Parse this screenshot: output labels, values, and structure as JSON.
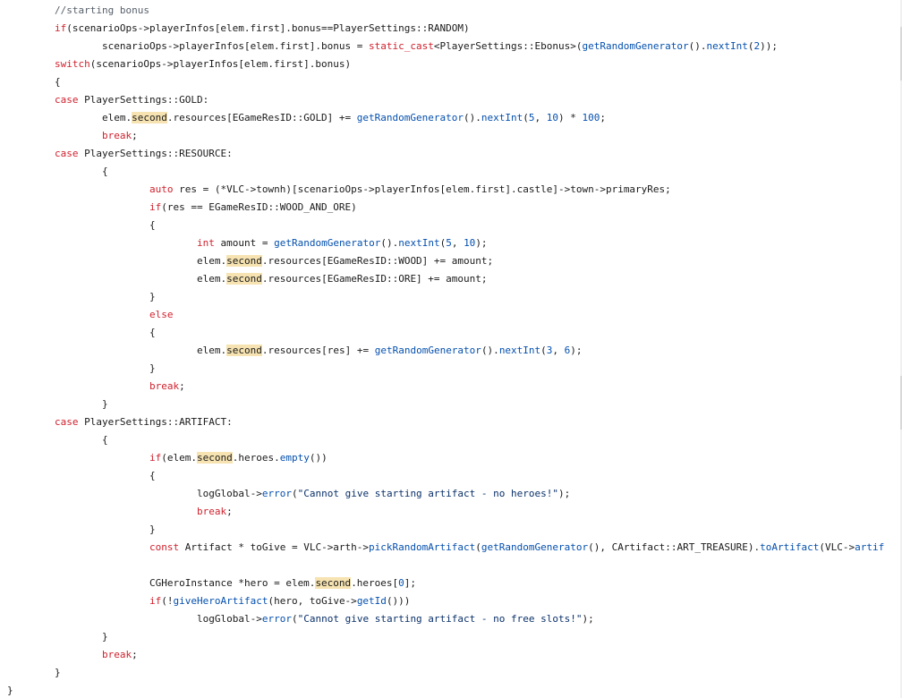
{
  "colors": {
    "keyword": "#cf222e",
    "function": "#0550ae",
    "number": "#0550ae",
    "string": "#0a3069",
    "comment": "#57606a",
    "highlight": "#f6e3b1"
  },
  "code_lines": [
    [
      [
        "\t//starting bonus",
        "cm"
      ]
    ],
    [
      [
        "\t",
        ""
      ],
      [
        "if",
        "kw"
      ],
      [
        "(scenarioOps->playerInfos[elem.first].bonus==PlayerSettings::RANDOM)",
        ""
      ]
    ],
    [
      [
        "\t\tscenarioOps->playerInfos[elem.first].bonus = ",
        ""
      ],
      [
        "static_cast",
        "kw"
      ],
      [
        "<PlayerSettings::Ebonus>(",
        ""
      ],
      [
        "getRandomGenerator",
        "fn"
      ],
      [
        "().",
        ""
      ],
      [
        "nextInt",
        "fn"
      ],
      [
        "(",
        ""
      ],
      [
        "2",
        "num"
      ],
      [
        "));",
        ""
      ]
    ],
    [
      [
        "\t",
        ""
      ],
      [
        "switch",
        "kw"
      ],
      [
        "(scenarioOps->playerInfos[elem.first].bonus)",
        ""
      ]
    ],
    [
      [
        "\t{",
        ""
      ]
    ],
    [
      [
        "\t",
        ""
      ],
      [
        "case",
        "kw"
      ],
      [
        " PlayerSettings::GOLD:",
        ""
      ]
    ],
    [
      [
        "\t\telem.",
        ""
      ],
      [
        "second",
        "hl"
      ],
      [
        ".resources[EGameResID::GOLD] += ",
        ""
      ],
      [
        "getRandomGenerator",
        "fn"
      ],
      [
        "().",
        ""
      ],
      [
        "nextInt",
        "fn"
      ],
      [
        "(",
        ""
      ],
      [
        "5",
        "num"
      ],
      [
        ", ",
        ""
      ],
      [
        "10",
        "num"
      ],
      [
        ") * ",
        ""
      ],
      [
        "100",
        "num"
      ],
      [
        ";",
        ""
      ]
    ],
    [
      [
        "\t\t",
        ""
      ],
      [
        "break",
        "kw"
      ],
      [
        ";",
        ""
      ]
    ],
    [
      [
        "\t",
        ""
      ],
      [
        "case",
        "kw"
      ],
      [
        " PlayerSettings::RESOURCE:",
        ""
      ]
    ],
    [
      [
        "\t\t{",
        ""
      ]
    ],
    [
      [
        "\t\t\t",
        ""
      ],
      [
        "auto",
        "kw"
      ],
      [
        " res = (*VLC->townh)[scenarioOps->playerInfos[elem.first].castle]->town->primaryRes;",
        ""
      ]
    ],
    [
      [
        "\t\t\t",
        ""
      ],
      [
        "if",
        "kw"
      ],
      [
        "(res == EGameResID::WOOD_AND_ORE)",
        ""
      ]
    ],
    [
      [
        "\t\t\t{",
        ""
      ]
    ],
    [
      [
        "\t\t\t\t",
        ""
      ],
      [
        "int",
        "kw"
      ],
      [
        " amount = ",
        ""
      ],
      [
        "getRandomGenerator",
        "fn"
      ],
      [
        "().",
        ""
      ],
      [
        "nextInt",
        "fn"
      ],
      [
        "(",
        ""
      ],
      [
        "5",
        "num"
      ],
      [
        ", ",
        ""
      ],
      [
        "10",
        "num"
      ],
      [
        ");",
        ""
      ]
    ],
    [
      [
        "\t\t\t\telem.",
        ""
      ],
      [
        "second",
        "hl"
      ],
      [
        ".resources[EGameResID::WOOD] += amount;",
        ""
      ]
    ],
    [
      [
        "\t\t\t\telem.",
        ""
      ],
      [
        "second",
        "hl"
      ],
      [
        ".resources[EGameResID::ORE] += amount;",
        ""
      ]
    ],
    [
      [
        "\t\t\t}",
        ""
      ]
    ],
    [
      [
        "\t\t\t",
        ""
      ],
      [
        "else",
        "kw"
      ]
    ],
    [
      [
        "\t\t\t{",
        ""
      ]
    ],
    [
      [
        "\t\t\t\telem.",
        ""
      ],
      [
        "second",
        "hl"
      ],
      [
        ".resources[res] += ",
        ""
      ],
      [
        "getRandomGenerator",
        "fn"
      ],
      [
        "().",
        ""
      ],
      [
        "nextInt",
        "fn"
      ],
      [
        "(",
        ""
      ],
      [
        "3",
        "num"
      ],
      [
        ", ",
        ""
      ],
      [
        "6",
        "num"
      ],
      [
        ");",
        ""
      ]
    ],
    [
      [
        "\t\t\t}",
        ""
      ]
    ],
    [
      [
        "\t\t\t",
        ""
      ],
      [
        "break",
        "kw"
      ],
      [
        ";",
        ""
      ]
    ],
    [
      [
        "\t\t}",
        ""
      ]
    ],
    [
      [
        "\t",
        ""
      ],
      [
        "case",
        "kw"
      ],
      [
        " PlayerSettings::ARTIFACT:",
        ""
      ]
    ],
    [
      [
        "\t\t{",
        ""
      ]
    ],
    [
      [
        "\t\t\t",
        ""
      ],
      [
        "if",
        "kw"
      ],
      [
        "(elem.",
        ""
      ],
      [
        "second",
        "hl"
      ],
      [
        ".heroes.",
        ""
      ],
      [
        "empty",
        "fn"
      ],
      [
        "())",
        ""
      ]
    ],
    [
      [
        "\t\t\t{",
        ""
      ]
    ],
    [
      [
        "\t\t\t\tlogGlobal->",
        ""
      ],
      [
        "error",
        "fn"
      ],
      [
        "(",
        ""
      ],
      [
        "\"Cannot give starting artifact - no heroes!\"",
        "str"
      ],
      [
        ");",
        ""
      ]
    ],
    [
      [
        "\t\t\t\t",
        ""
      ],
      [
        "break",
        "kw"
      ],
      [
        ";",
        ""
      ]
    ],
    [
      [
        "\t\t\t}",
        ""
      ]
    ],
    [
      [
        "\t\t\t",
        ""
      ],
      [
        "const",
        "kw"
      ],
      [
        " Artifact * toGive = VLC->arth->",
        ""
      ],
      [
        "pickRandomArtifact",
        "fn"
      ],
      [
        "(",
        ""
      ],
      [
        "getRandomGenerator",
        "fn"
      ],
      [
        "(), CArtifact::ART_TREASURE).",
        ""
      ],
      [
        "toArtifact",
        "fn"
      ],
      [
        "(VLC->",
        ""
      ],
      [
        "artif",
        "fn"
      ]
    ],
    [],
    [
      [
        "\t\t\tCGHeroInstance *hero = elem.",
        ""
      ],
      [
        "second",
        "hl"
      ],
      [
        ".heroes[",
        ""
      ],
      [
        "0",
        "num"
      ],
      [
        "];",
        ""
      ]
    ],
    [
      [
        "\t\t\t",
        ""
      ],
      [
        "if",
        "kw"
      ],
      [
        "(!",
        ""
      ],
      [
        "giveHeroArtifact",
        "fn"
      ],
      [
        "(hero, toGive->",
        ""
      ],
      [
        "getId",
        "fn"
      ],
      [
        "()))",
        ""
      ]
    ],
    [
      [
        "\t\t\t\tlogGlobal->",
        ""
      ],
      [
        "error",
        "fn"
      ],
      [
        "(",
        ""
      ],
      [
        "\"Cannot give starting artifact - no free slots!\"",
        "str"
      ],
      [
        ");",
        ""
      ]
    ],
    [
      [
        "\t\t}",
        ""
      ]
    ],
    [
      [
        "\t\t",
        ""
      ],
      [
        "break",
        "kw"
      ],
      [
        ";",
        ""
      ]
    ],
    [
      [
        "\t}",
        ""
      ]
    ],
    [
      [
        "}",
        ""
      ]
    ]
  ]
}
